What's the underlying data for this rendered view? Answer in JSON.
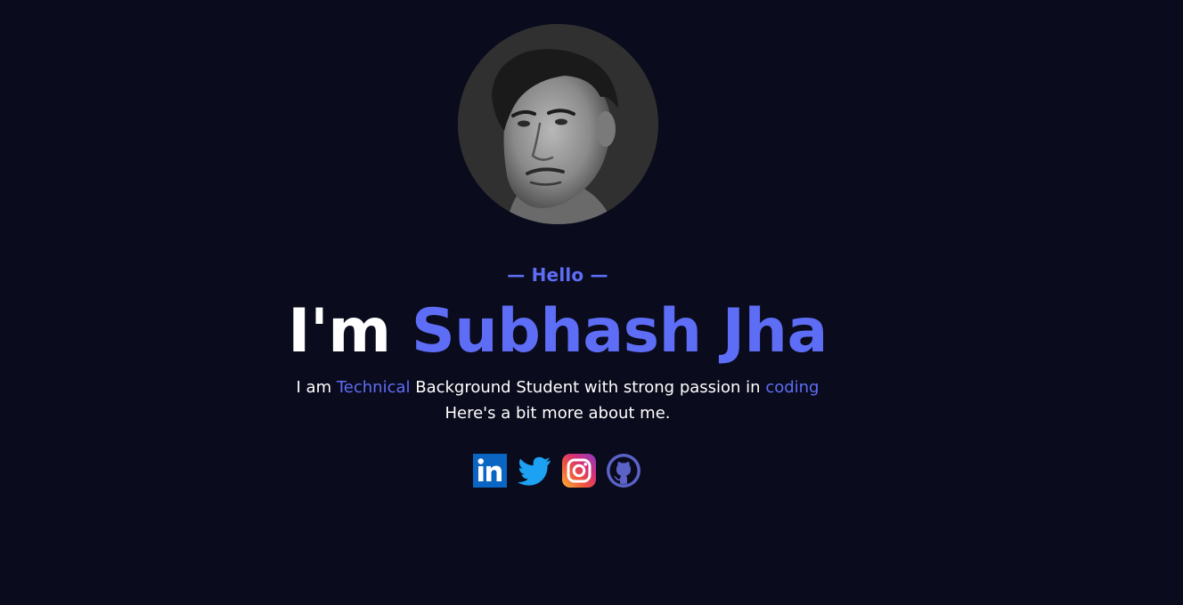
{
  "hero": {
    "greeting": "— Hello —",
    "headline_prefix": "I'm ",
    "headline_name": "Subhash Jha",
    "tagline_part1": "I am ",
    "tagline_accent1": "Technical",
    "tagline_part2": " Background Student with strong passion in ",
    "tagline_accent2": "coding",
    "subline": "Here's a bit more about me."
  },
  "colors": {
    "background": "#0a0b1c",
    "accent": "#5e6df6",
    "text": "#ffffff",
    "avatar_bg": "#303030"
  },
  "avatar": {
    "icon": "profile-photo"
  },
  "socials": [
    {
      "icon": "linkedin-icon",
      "color": "#0a66c2"
    },
    {
      "icon": "twitter-icon",
      "color": "#1da1f2"
    },
    {
      "icon": "instagram-icon",
      "color": "#e1306c"
    },
    {
      "icon": "github-icon",
      "color": "#5b62c8"
    }
  ]
}
